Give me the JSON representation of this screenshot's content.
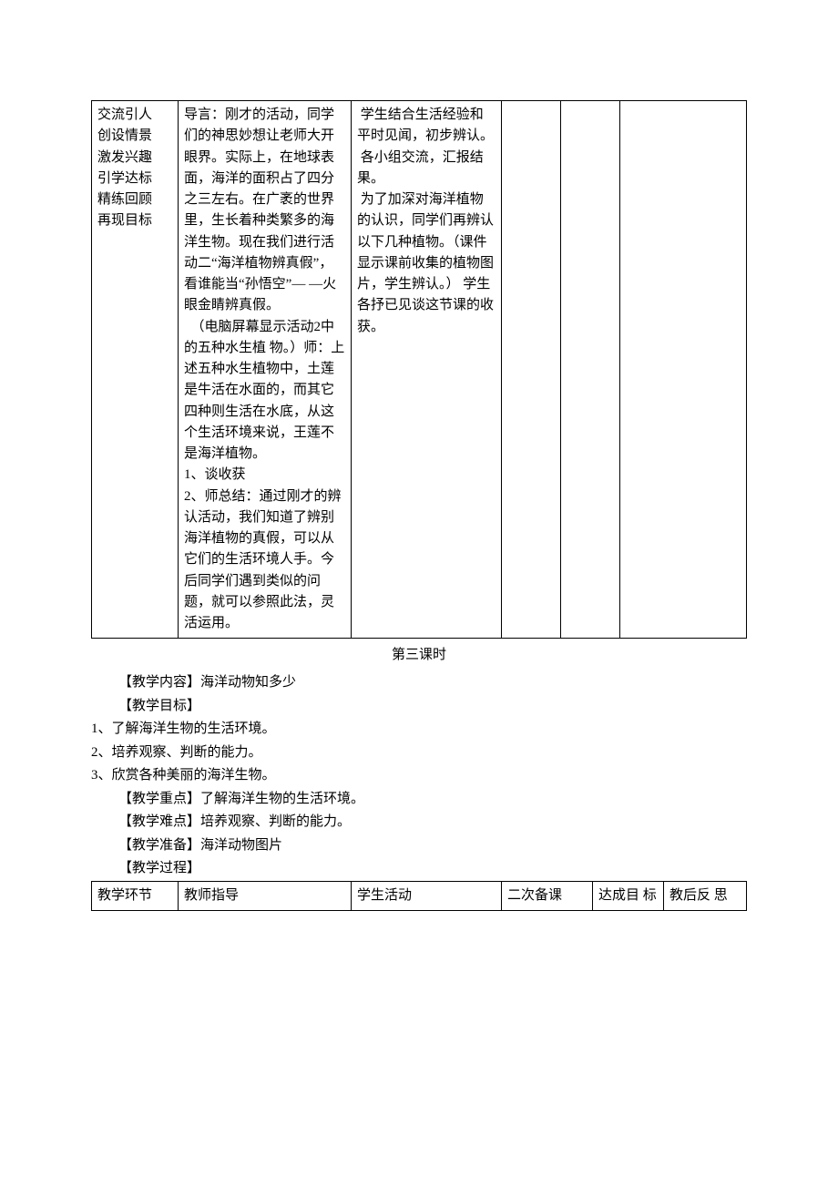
{
  "table1": {
    "col1_lines": [
      "交流引人",
      "创设情景",
      "激发兴趣",
      "引学达标",
      "精练回顾",
      "再现目标"
    ],
    "col2": "导言：刚才的活动，同学们的神思妙想让老师大开眼界。实际上，在地球表面，海洋的面积占了四分之三左右。在广袤的世界里，生长着种类繁多的海洋生物。现在我们进行活动二“海洋植物辨真假”，看谁能当“孙悟空”— —火眼金睛辨真假。\n  （电脑屏幕显示活动2中的五种水生植 物。）师：上述五种水生植物中，土莲是牛活在水面的，而其它四种则生活在水底，从这个生活环境来说，王莲不是海洋植物。\n1、谈收获\n2、师总结：通过刚才的辨认活动，我们知道了辨别海洋植物的真假，可以从它们的生活环境人手。今后同学们遇到类似的问题，就可以参照此法，灵活运用。\n",
    "col3": " 学生结合生活经验和平时见闻，初步辨认。\n 各小组交流，汇报结果。\n 为了加深对海洋植物的认识，同学们再辨认以下几种植物。（课件显示课前收集的植物图片，学生辨认。） 学生各抒已见谈这节课的收获。"
  },
  "section": {
    "title": "第三课时",
    "content_label": "【教学内容】",
    "content_text": "海洋动物知多少",
    "goal_label": "【教学目标】",
    "goals": [
      "1、了解海洋生物的生活环境。",
      "2、培养观察、判断的能力。",
      "3、欣赏各种美丽的海洋生物。"
    ],
    "keypoint_label": "【教学重点】",
    "keypoint_text": "了解海洋生物的生活环境。",
    "difficulty_label": "【教学难点】",
    "difficulty_text": "培养观察、判断的能力。",
    "prep_label": "【教学准备】",
    "prep_text": "海洋动物图片",
    "process_label": "【教学过程】"
  },
  "table2": {
    "h1": "教学环节",
    "h2": "教师指导",
    "h3": "学生活动",
    "h4": "二次备课",
    "h5": "达成目  标",
    "h6": "教后反  思"
  }
}
